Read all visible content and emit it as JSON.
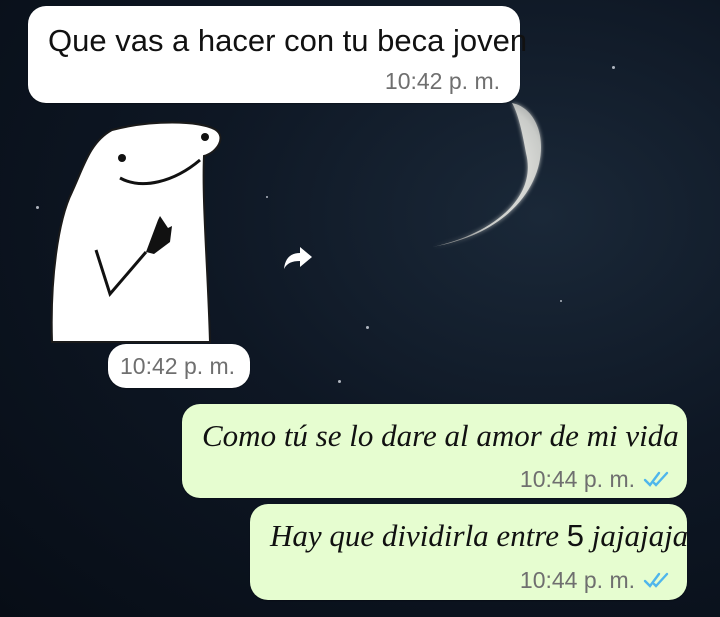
{
  "messages": [
    {
      "direction": "incoming",
      "text": "Que vas a hacer con tu beca joven",
      "time": "10:42 p. m."
    },
    {
      "direction": "incoming",
      "type": "sticker",
      "sticker": "flork-pointing-sticker",
      "time": "10:42 p. m."
    },
    {
      "direction": "outgoing",
      "text": "Como tú se lo dare al amor de mi vida",
      "time": "10:44 p. m.",
      "status": "read"
    },
    {
      "direction": "outgoing",
      "text_before": "Hay que dividirla entre ",
      "text_number": "5",
      "text_after": " jajajaja",
      "time": "10:44 p. m.",
      "status": "read"
    }
  ],
  "icons": {
    "forward": "forward-arrow-icon",
    "read_receipt": "double-check-icon"
  },
  "colors": {
    "incoming_bubble": "#ffffff",
    "outgoing_bubble": "#e6fdd0",
    "read_ticks": "#4fb6ec",
    "timestamp": "#6f6f6f"
  }
}
